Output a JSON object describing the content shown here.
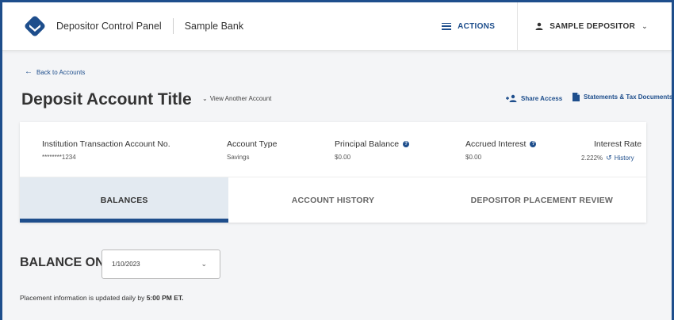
{
  "header": {
    "app_title": "Depositor Control Panel",
    "bank_name": "Sample Bank",
    "actions_label": "ACTIONS",
    "user_label": "SAMPLE DEPOSITOR",
    "accent_color": "#1e4e8c"
  },
  "nav": {
    "back_label": "Back to Accounts"
  },
  "page": {
    "title": "Deposit Account Title",
    "view_another_label": "View Another Account",
    "share_access_label": "Share Access",
    "statements_label": "Statements & Tax Documents"
  },
  "summary": {
    "account_no": {
      "label": "Institution Transaction Account No.",
      "value": "********1234"
    },
    "account_type": {
      "label": "Account Type",
      "value": "Savings"
    },
    "principal_balance": {
      "label": "Principal Balance",
      "value": "$0.00"
    },
    "accrued_interest": {
      "label": "Accrued Interest",
      "value": "$0.00"
    },
    "interest_rate": {
      "label": "Interest Rate",
      "value": "2.222%",
      "history_label": "History"
    }
  },
  "tabs": [
    {
      "label": "BALANCES",
      "active": true
    },
    {
      "label": "ACCOUNT HISTORY",
      "active": false
    },
    {
      "label": "DEPOSITOR PLACEMENT REVIEW",
      "active": false
    }
  ],
  "balance": {
    "label": "BALANCE ON",
    "selected_date": "1/10/2023",
    "note_prefix": "Placement information is updated daily by",
    "note_time": "5:00 PM ET."
  }
}
